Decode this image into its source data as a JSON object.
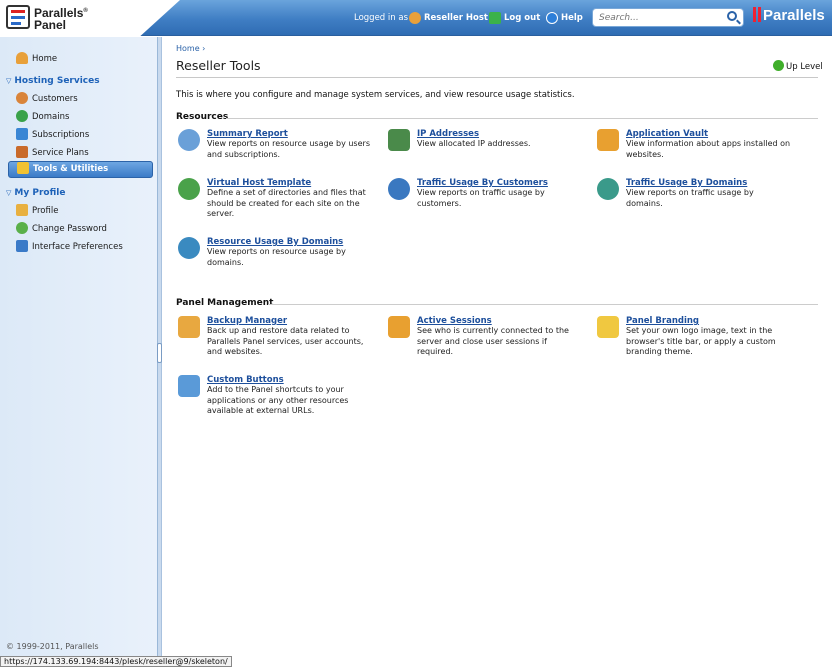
{
  "header": {
    "logo_line1": "Parallels",
    "logo_line2": "Panel",
    "logged_in_label": "Logged in as",
    "user_name": "Reseller Host",
    "logout_label": "Log out",
    "help_label": "Help",
    "search_placeholder": "Search...",
    "brand": "Parallels"
  },
  "sidebar": {
    "home": "Home",
    "hosting_services": {
      "title": "Hosting Services",
      "items": [
        "Customers",
        "Domains",
        "Subscriptions",
        "Service Plans",
        "Tools & Utilities"
      ]
    },
    "my_profile": {
      "title": "My Profile",
      "items": [
        "Profile",
        "Change Password",
        "Interface Preferences"
      ]
    },
    "copyright": "© 1999-2011, Parallels"
  },
  "main": {
    "breadcrumb": "Home ›",
    "title": "Reseller Tools",
    "up_level": "Up Level",
    "intro": "This is where you configure and manage system services, and view resource usage statistics.",
    "sections": [
      {
        "title": "Resources",
        "tools": [
          {
            "name": "Summary Report",
            "desc": "View reports on resource usage by users and subscriptions."
          },
          {
            "name": "IP Addresses",
            "desc": "View allocated IP addresses."
          },
          {
            "name": "Application Vault",
            "desc": "View information about apps installed on websites."
          },
          {
            "name": "Virtual Host Template",
            "desc": "Define a set of directories and files that should be created for each site on the server."
          },
          {
            "name": "Traffic Usage By Customers",
            "desc": "View reports on traffic usage by customers."
          },
          {
            "name": "Traffic Usage By Domains",
            "desc": "View reports on traffic usage by domains."
          },
          {
            "name": "Resource Usage By Domains",
            "desc": "View reports on resource usage by domains."
          }
        ]
      },
      {
        "title": "Panel Management",
        "tools": [
          {
            "name": "Backup Manager",
            "desc": "Back up and restore data related to Parallels Panel services, user accounts, and websites."
          },
          {
            "name": "Active Sessions",
            "desc": "See who is currently connected to the server and close user sessions if required."
          },
          {
            "name": "Panel Branding",
            "desc": "Set your own logo image, text in the browser's title bar, or apply a custom branding theme."
          },
          {
            "name": "Custom Buttons",
            "desc": "Add to the Panel shortcuts to your applications or any other resources available at external URLs."
          }
        ]
      }
    ]
  },
  "status_bar": "https://174.133.69.194:8443/plesk/reseller@9/skeleton/",
  "colors": {
    "accent": "#3f7ec4",
    "link": "#1d4f9c",
    "section_heading": "#1e62b8"
  }
}
